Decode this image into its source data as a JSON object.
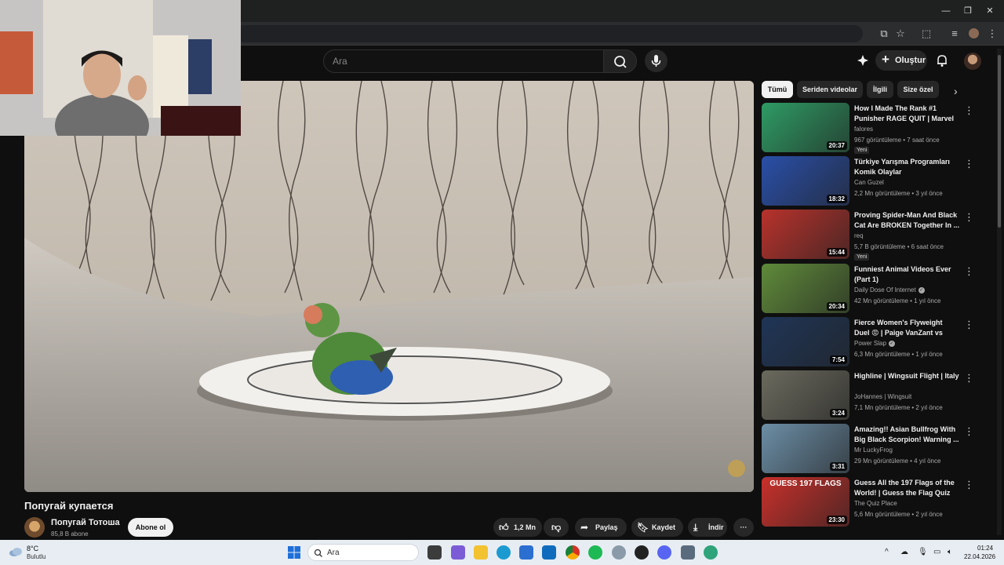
{
  "search": {
    "placeholder": "Ara"
  },
  "header": {
    "create_label": "Oluştur"
  },
  "video": {
    "title": "Попугай купается",
    "channel": "Попугай Тотоша",
    "subscribers": "85,8 B abone",
    "subscribe_label": "Abone ol",
    "likes": "1,2 Mn",
    "share_label": "Paylaş",
    "save_label": "Kaydet",
    "download_label": "İndir"
  },
  "chips": [
    "Tümü",
    "Seriden videolar",
    "İlgili",
    "Size özel"
  ],
  "recommendations": [
    {
      "title": "How I Made The Rank #1 Punisher RAGE QUIT | Marvel ...",
      "channel": "falores",
      "meta": "967 görüntüleme • 7 saat önce",
      "badge": "Yeni",
      "duration": "20:37",
      "thumb_color": "#2e9b64"
    },
    {
      "title": "Türkiye Yarışma Programları Komik Olaylar",
      "channel": "Can Guzel",
      "meta": "2,2 Mn görüntüleme • 3 yıl önce",
      "badge": "",
      "duration": "18:32",
      "thumb_color": "#2a4fa8"
    },
    {
      "title": "Proving Spider-Man And Black Cat Are BROKEN Together In ...",
      "channel": "req",
      "meta": "5,7 B görüntüleme • 6 saat önce",
      "badge": "Yeni",
      "duration": "15:44",
      "thumb_color": "#b8322c"
    },
    {
      "title": "Funniest Animal Videos Ever (Part 1)",
      "channel": "Daily Dose Of Internet",
      "meta": "42 Mn görüntüleme • 1 yıl önce",
      "badge": "",
      "duration": "20:34",
      "thumb_color": "#5f8a3a"
    },
    {
      "title": "Fierce Women's Flyweight Duel 😡 | Paige VanZant vs Mikael-...",
      "channel": "Power Slap",
      "meta": "6,3 Mn görüntüleme • 1 yıl önce",
      "badge": "",
      "duration": "7:54",
      "thumb_color": "#1f3557"
    },
    {
      "title": "Highline | Wingsuit Flight | Italy",
      "channel": "JoHannes | Wingsuit",
      "meta": "7,1 Mn görüntüleme • 2 yıl önce",
      "badge": "",
      "duration": "3:24",
      "thumb_color": "#6b6a5e"
    },
    {
      "title": "Amazing!! Asian Bullfrog With Big Black Scorpion! Warning ...",
      "channel": "Mr LuckyFrog",
      "meta": "29 Mn görüntüleme • 4 yıl önce",
      "badge": "",
      "duration": "3:31",
      "thumb_color": "#6c8ea6"
    },
    {
      "title": "Guess All the 197 Flags of the World! | Guess the Flag Quiz",
      "channel": "The Quiz Place",
      "meta": "5,6 Mn görüntüleme • 2 yıl önce",
      "badge": "",
      "duration": "23:30",
      "thumb_color": "#c8302b",
      "thumb_text": "GUESS 197 FLAGS"
    }
  ],
  "taskbar": {
    "weather_temp": "8°C",
    "weather_desc": "Bulutlu",
    "search_label": "Ara",
    "time": "01:24",
    "date": "22.04.2026"
  }
}
